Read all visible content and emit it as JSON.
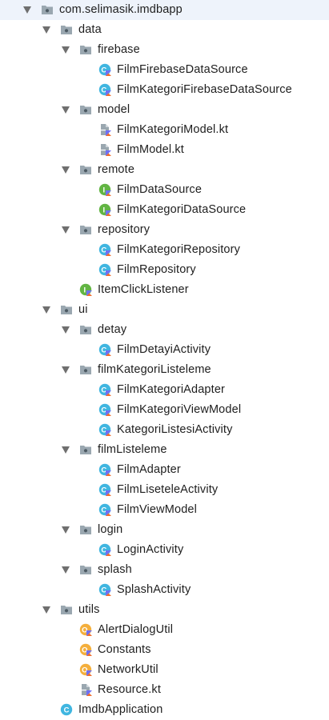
{
  "tree": {
    "items": [
      {
        "label": "com.selimasik.imdbapp",
        "type": "package",
        "depth": 0,
        "expanded": true
      },
      {
        "label": "data",
        "type": "package",
        "depth": 1,
        "expanded": true
      },
      {
        "label": "firebase",
        "type": "package",
        "depth": 2,
        "expanded": true
      },
      {
        "label": "FilmFirebaseDataSource",
        "type": "kotlin-class",
        "depth": 3
      },
      {
        "label": "FilmKategoriFirebaseDataSource",
        "type": "kotlin-class",
        "depth": 3
      },
      {
        "label": "model",
        "type": "package",
        "depth": 2,
        "expanded": true
      },
      {
        "label": "FilmKategoriModel.kt",
        "type": "kotlin-file",
        "depth": 3
      },
      {
        "label": "FilmModel.kt",
        "type": "kotlin-file",
        "depth": 3
      },
      {
        "label": "remote",
        "type": "package",
        "depth": 2,
        "expanded": true
      },
      {
        "label": "FilmDataSource",
        "type": "kotlin-interface",
        "depth": 3
      },
      {
        "label": "FilmKategoriDataSource",
        "type": "kotlin-interface",
        "depth": 3
      },
      {
        "label": "repository",
        "type": "package",
        "depth": 2,
        "expanded": true
      },
      {
        "label": "FilmKategoriRepository",
        "type": "kotlin-class",
        "depth": 3
      },
      {
        "label": "FilmRepository",
        "type": "kotlin-class",
        "depth": 3
      },
      {
        "label": "ItemClickListener",
        "type": "kotlin-interface",
        "depth": 2
      },
      {
        "label": "ui",
        "type": "package",
        "depth": 1,
        "expanded": true
      },
      {
        "label": "detay",
        "type": "package",
        "depth": 2,
        "expanded": true
      },
      {
        "label": "FilmDetayiActivity",
        "type": "kotlin-class",
        "depth": 3
      },
      {
        "label": "filmKategoriListeleme",
        "type": "package",
        "depth": 2,
        "expanded": true
      },
      {
        "label": "FilmKategoriAdapter",
        "type": "kotlin-class",
        "depth": 3
      },
      {
        "label": "FilmKategoriViewModel",
        "type": "kotlin-class",
        "depth": 3
      },
      {
        "label": "KategoriListesiActivity",
        "type": "kotlin-class",
        "depth": 3
      },
      {
        "label": "filmListeleme",
        "type": "package",
        "depth": 2,
        "expanded": true
      },
      {
        "label": "FilmAdapter",
        "type": "kotlin-class",
        "depth": 3
      },
      {
        "label": "FilmLiseteleActivity",
        "type": "kotlin-class",
        "depth": 3
      },
      {
        "label": "FilmViewModel",
        "type": "kotlin-class",
        "depth": 3
      },
      {
        "label": "login",
        "type": "package",
        "depth": 2,
        "expanded": true
      },
      {
        "label": "LoginActivity",
        "type": "kotlin-class",
        "depth": 3
      },
      {
        "label": "splash",
        "type": "package",
        "depth": 2,
        "expanded": true
      },
      {
        "label": "SplashActivity",
        "type": "kotlin-class",
        "depth": 3
      },
      {
        "label": "utils",
        "type": "package",
        "depth": 1,
        "expanded": true
      },
      {
        "label": "AlertDialogUtil",
        "type": "kotlin-object",
        "depth": 2
      },
      {
        "label": "Constants",
        "type": "kotlin-object",
        "depth": 2
      },
      {
        "label": "NetworkUtil",
        "type": "kotlin-object",
        "depth": 2
      },
      {
        "label": "Resource.kt",
        "type": "kotlin-file",
        "depth": 2
      },
      {
        "label": "ImdbApplication",
        "type": "java-class",
        "depth": 1
      }
    ]
  },
  "colors": {
    "text": "#1e1e1e",
    "arrow": "#6f6f6f",
    "folder": "#9aa7b0",
    "folder_dot": "#4d5a63",
    "class": "#40b6e0",
    "interface": "#62b543",
    "object": "#f4af3d",
    "kotlin_a": "#6d6ff5",
    "kotlin_b": "#f26c2d"
  }
}
